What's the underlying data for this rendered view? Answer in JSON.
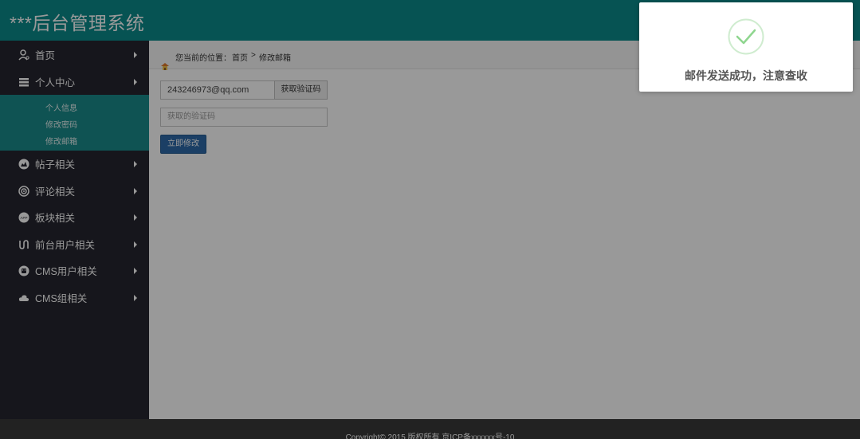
{
  "header": {
    "title": "***后台管理系统"
  },
  "sidebar": {
    "items": [
      {
        "label": "首页",
        "icon": "user-icon"
      },
      {
        "label": "个人中心",
        "icon": "stack-icon"
      },
      {
        "label": "帖子相关",
        "icon": "chart-icon"
      },
      {
        "label": "评论相关",
        "icon": "target-icon"
      },
      {
        "label": "板块相关",
        "icon": "app-icon"
      },
      {
        "label": "前台用户相关",
        "icon": "link-icon"
      },
      {
        "label": "CMS用户相关",
        "icon": "android-icon"
      },
      {
        "label": "CMS组相关",
        "icon": "cloud-icon"
      }
    ],
    "submenu": [
      "个人信息",
      "修改密码",
      "修改邮箱"
    ]
  },
  "breadcrumb": {
    "prefix": "您当前的位置：",
    "home": "首页",
    "separator": ">",
    "current": "修改邮箱"
  },
  "form": {
    "email_value": "243246973@qq.com",
    "get_code_label": "获取验证码",
    "code_placeholder": "获取的验证码",
    "submit_label": "立即修改"
  },
  "footer": {
    "text": "Copyright© 2015 版权所有 京ICP备xxxxxx号-10"
  },
  "toast": {
    "message": "邮件发送成功，注意查收"
  },
  "colors": {
    "header_bg": "#0b8b8a",
    "sidebar_bg": "#26262f",
    "submenu_bg": "#1a8b8a",
    "primary_button": "#2d6aa8",
    "success_check": "#8fd68f"
  }
}
